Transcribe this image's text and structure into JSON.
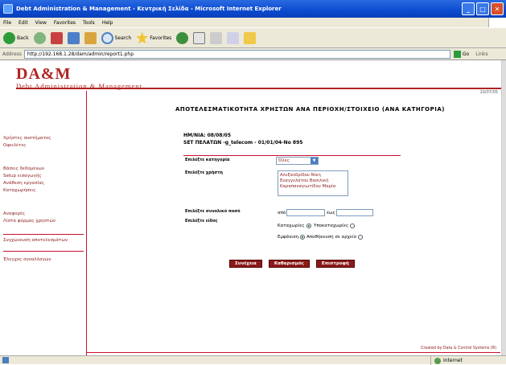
{
  "window": {
    "title": "Debt Administration & Management - Κεντρική Σελίδα - Microsoft Internet Explorer"
  },
  "menubar": {
    "items": [
      "File",
      "Edit",
      "View",
      "Favorites",
      "Tools",
      "Help"
    ]
  },
  "toolbar": {
    "back": "Back",
    "search": "Search",
    "favorites": "Favorites"
  },
  "addressbar": {
    "label": "Address",
    "url": "http://192.168.1.28/dam/admin/report1.php",
    "go": "Go",
    "links": "Links"
  },
  "header": {
    "logo_main": "DA&M",
    "logo_sub": "Debt Administration & Management",
    "date": "10/07/05"
  },
  "sidebar": {
    "items": [
      "Χρήστες συστήματος",
      "Οφειλέτες",
      "Βάσεις δεδομένων",
      "Setup εισαγωγής",
      "Ανάθεση εργασίας",
      "Καταχωρήσεις",
      "Αναφορές",
      "Λίστα φόρμας χρηστών",
      "Συγχώνευση αποτελεσμάτων",
      "Έλεγχος συναλλαγών"
    ]
  },
  "report": {
    "title": "ΑΠΟΤΕΛΕΣΜΑΤΙΚΟΤΗΤΑ ΧΡΗΣΤΩΝ ΑΝΑ ΠΕΡΙΟΧΗ/ΣΤΟΙΧΕΙΟ (ΑΝΑ ΚΑΤΗΓΟΡΙΑ)",
    "date_line": "ΗΜ/ΝΙΑ: 08/08/05",
    "set_line": "SET ΠΕΛΑΤΩΝ -g_telecom - 01/01/04-No 895"
  },
  "form": {
    "category_label": "Επιλέξτε κατηγορία",
    "category_value": "Όλες",
    "users_label": "Επιλέξτε χρήστη",
    "users_options": [
      "Αλεξανδρίδου Νίκη",
      "Ευαγγελάτου Βασιλική",
      "Καραπαναγιωτίδου Μαρία"
    ],
    "amount_label": "Επιλέξτε συνολικό ποσό",
    "from_label": "από",
    "to_label": "έως",
    "type_label": "Επιλέξτε είδος",
    "radio_opt1": "Καταχωρίες",
    "radio_opt2": "Υποκαταχωρίες",
    "radio_opt3": "Εμφάνιση",
    "radio_opt4": "Αποθήκευση σε αρχείο"
  },
  "buttons": {
    "submit": "Συνέχεια",
    "clear": "Καθαρισμός",
    "back": "Επιστροφή"
  },
  "footer": {
    "credit": "Created by Data & Control Systems (R)"
  },
  "statusbar": {
    "zone": "Internet"
  }
}
